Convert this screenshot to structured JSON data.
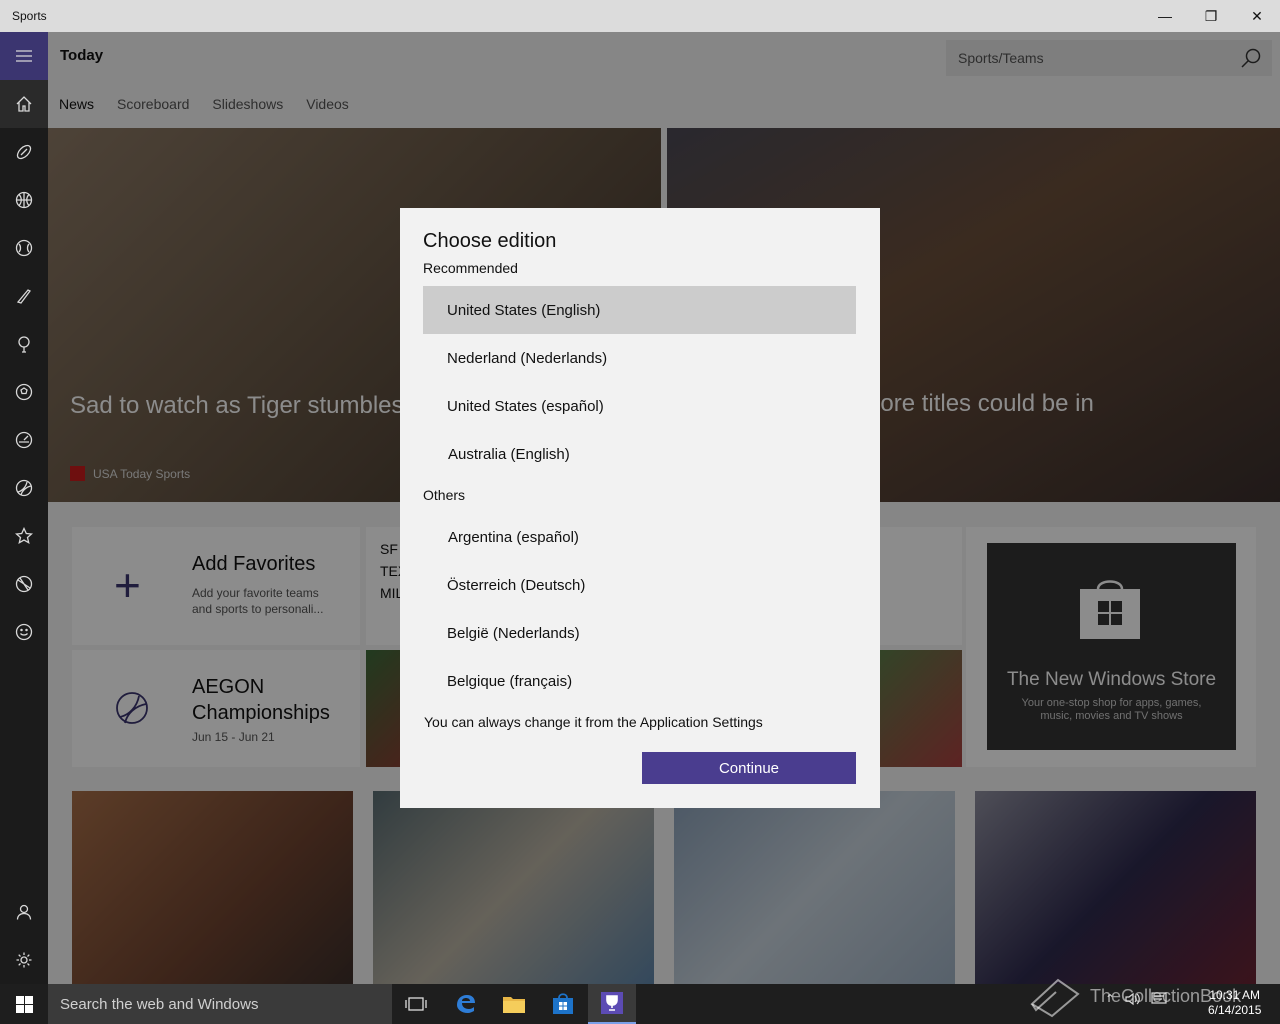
{
  "window": {
    "title": "Sports"
  },
  "header": {
    "title": "Today",
    "search_placeholder": "Sports/Teams"
  },
  "tabs": [
    "News",
    "Scoreboard",
    "Slideshows",
    "Videos"
  ],
  "hero": {
    "left_caption": "Sad to watch as Tiger stumbles lows",
    "left_source": "USA Today Sports",
    "right_caption": "nore titles could be in"
  },
  "tiles": {
    "favorites": {
      "title": "Add Favorites",
      "desc": "Add your favorite teams and sports to personali..."
    },
    "event": {
      "title": "AEGON Championships",
      "dates": "Jun 15 - Jun 21"
    },
    "score_lines": [
      "SF",
      "TEX",
      "MIL"
    ],
    "store": {
      "title": "The New Windows Store",
      "desc": "Your one-stop shop for apps, games, music, movies and TV shows"
    }
  },
  "dialog": {
    "title": "Choose edition",
    "recommended_label": "Recommended",
    "recommended": [
      "United States (English)",
      "Nederland (Nederlands)",
      "United States (español)",
      "Australia (English)"
    ],
    "others_label": "Others",
    "others": [
      "Argentina (español)",
      "Österreich (Deutsch)",
      "België (Nederlands)",
      "Belgique (français)"
    ],
    "note": "You can always change it from the Application Settings",
    "continue_label": "Continue"
  },
  "taskbar": {
    "search_placeholder": "Search the web and Windows",
    "time": "10:31 AM",
    "date": "6/14/2015",
    "watermark": "TheCollectionBook"
  },
  "colors": {
    "accent": "#4a3d8f",
    "selected_row": "#cccccc"
  }
}
